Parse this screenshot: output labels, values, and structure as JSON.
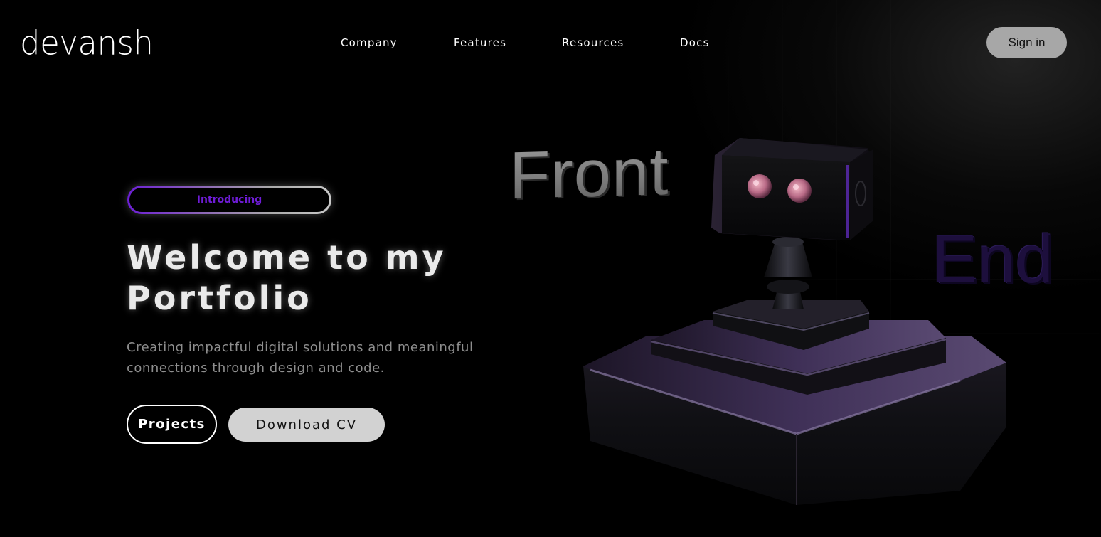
{
  "brand": {
    "logo_text": "devansh"
  },
  "nav": {
    "items": [
      {
        "label": "Company"
      },
      {
        "label": "Features"
      },
      {
        "label": "Resources"
      },
      {
        "label": "Docs"
      }
    ],
    "signin_label": "Sign in"
  },
  "hero": {
    "badge": "Introducing",
    "title": "Welcome to my Portfolio",
    "subtitle": "Creating impactful digital solutions and meaningful connections through design and code.",
    "primary_button": "Projects",
    "secondary_button": "Download CV"
  },
  "illustration": {
    "word_1": "Front",
    "word_2": "End",
    "icon": "robot-on-pedestal"
  },
  "colors": {
    "background": "#000000",
    "accent_purple": "#6f1cd8",
    "signin_bg": "#a7a7a7",
    "cv_button_bg": "#d2d2d2",
    "subtitle_text": "#8e8e8e"
  }
}
